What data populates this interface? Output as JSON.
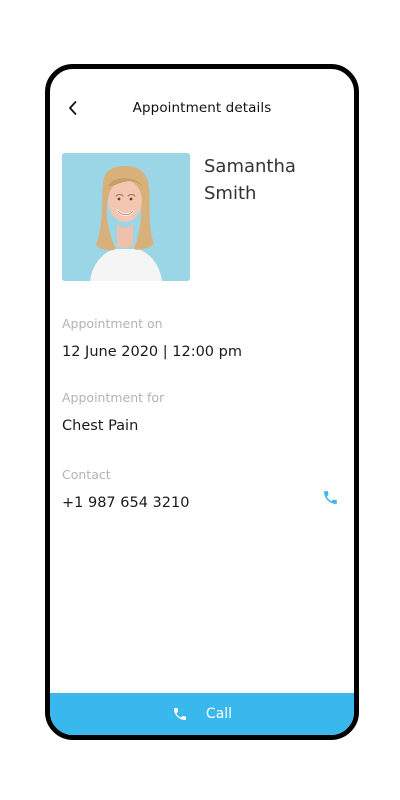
{
  "header": {
    "title": "Appointment details",
    "back_icon": "chevron-left-icon"
  },
  "patient": {
    "name_first": "Samantha",
    "name_last": "Smith",
    "avatar": "patient-photo"
  },
  "appointment": {
    "datetime_label": "Appointment on",
    "datetime_value": "12 June 2020 | 12:00 pm",
    "purpose_label": "Appointment for",
    "purpose_value": "Chest Pain",
    "contact_label": "Contact",
    "contact_value": "+1 987 654 3210",
    "contact_icon": "phone-icon"
  },
  "footer": {
    "call_label": "Call",
    "call_icon": "phone-icon"
  },
  "colors": {
    "accent": "#39b8ee",
    "label": "#b3b3b3",
    "text": "#1a1a1a",
    "frame": "#000000"
  }
}
